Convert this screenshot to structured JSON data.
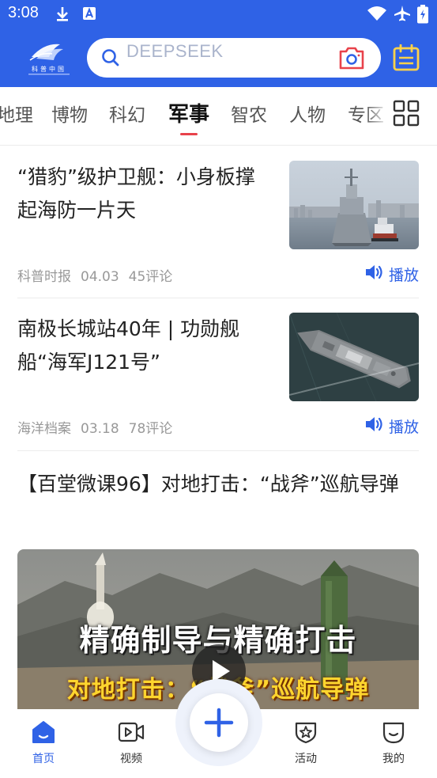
{
  "status": {
    "time": "3:08",
    "icons": [
      "download-icon",
      "notification-a-icon",
      "wifi-icon",
      "airplane-icon",
      "battery-icon"
    ]
  },
  "header": {
    "logo_name": "科普中国 logo",
    "search": {
      "placeholder": "DEEPSEEK",
      "icon": "search-icon",
      "camera_icon": "camera-icon"
    },
    "calendar_icon": "calendar-icon",
    "background_color": "#2f62e6"
  },
  "tabs": {
    "items": [
      {
        "label": "地理"
      },
      {
        "label": "博物"
      },
      {
        "label": "科幻"
      },
      {
        "label": "军事"
      },
      {
        "label": "智农"
      },
      {
        "label": "人物"
      },
      {
        "label": "专区"
      }
    ],
    "active_index": 3,
    "underline_color": "#e8424b",
    "more_icon": "grid-icon"
  },
  "articles": [
    {
      "title": "“猎豹”级护卫舰：小身板撑起海防一片天",
      "source": "科普时报",
      "date": "04.03",
      "comments": "45评论",
      "play_label": "播放"
    },
    {
      "title": "南极长城站40年 | 功勋舰船“海军J121号”",
      "source": "海洋档案",
      "date": "03.18",
      "comments": "78评论",
      "play_label": "播放"
    }
  ],
  "video_article": {
    "title": "【百堂微课96】对地打击：“战斧”巡航导弹",
    "thumbnail_caption_1": "精确制导与精确打击",
    "thumbnail_caption_2": "对地打击：“战斧”巡航导弹"
  },
  "bottom_nav": {
    "items": [
      {
        "label": "首页",
        "icon": "home-icon",
        "active": true
      },
      {
        "label": "视频",
        "icon": "video-icon",
        "active": false
      },
      {
        "label": "活动",
        "icon": "activity-icon",
        "active": false
      },
      {
        "label": "我的",
        "icon": "profile-icon",
        "active": false
      }
    ],
    "fab_icon": "plus-icon",
    "accent_color": "#2f62e6"
  }
}
